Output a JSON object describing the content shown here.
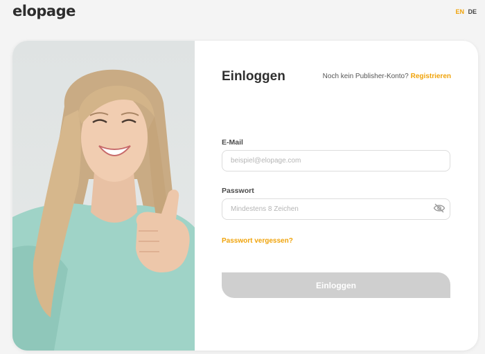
{
  "header": {
    "logo_text": "elopage",
    "languages": [
      {
        "code": "EN",
        "active": true
      },
      {
        "code": "DE",
        "active": false
      }
    ]
  },
  "login": {
    "title": "Einloggen",
    "signup_prompt": "Noch kein Publisher-Konto?",
    "signup_link": "Registrieren",
    "email_label": "E-Mail",
    "email_placeholder": "beispiel@elopage.com",
    "password_label": "Passwort",
    "password_placeholder": "Mindestens 8 Zeichen",
    "forgot_password": "Passwort vergessen?",
    "submit_label": "Einloggen"
  },
  "theme": {
    "accent": "#f0a30a",
    "button_disabled": "#cfcfcf",
    "text_dark": "#2f2f2f"
  },
  "icons": {
    "password_toggle": "eye-slash-icon",
    "photo": "woman-thumbs-up-photo"
  }
}
